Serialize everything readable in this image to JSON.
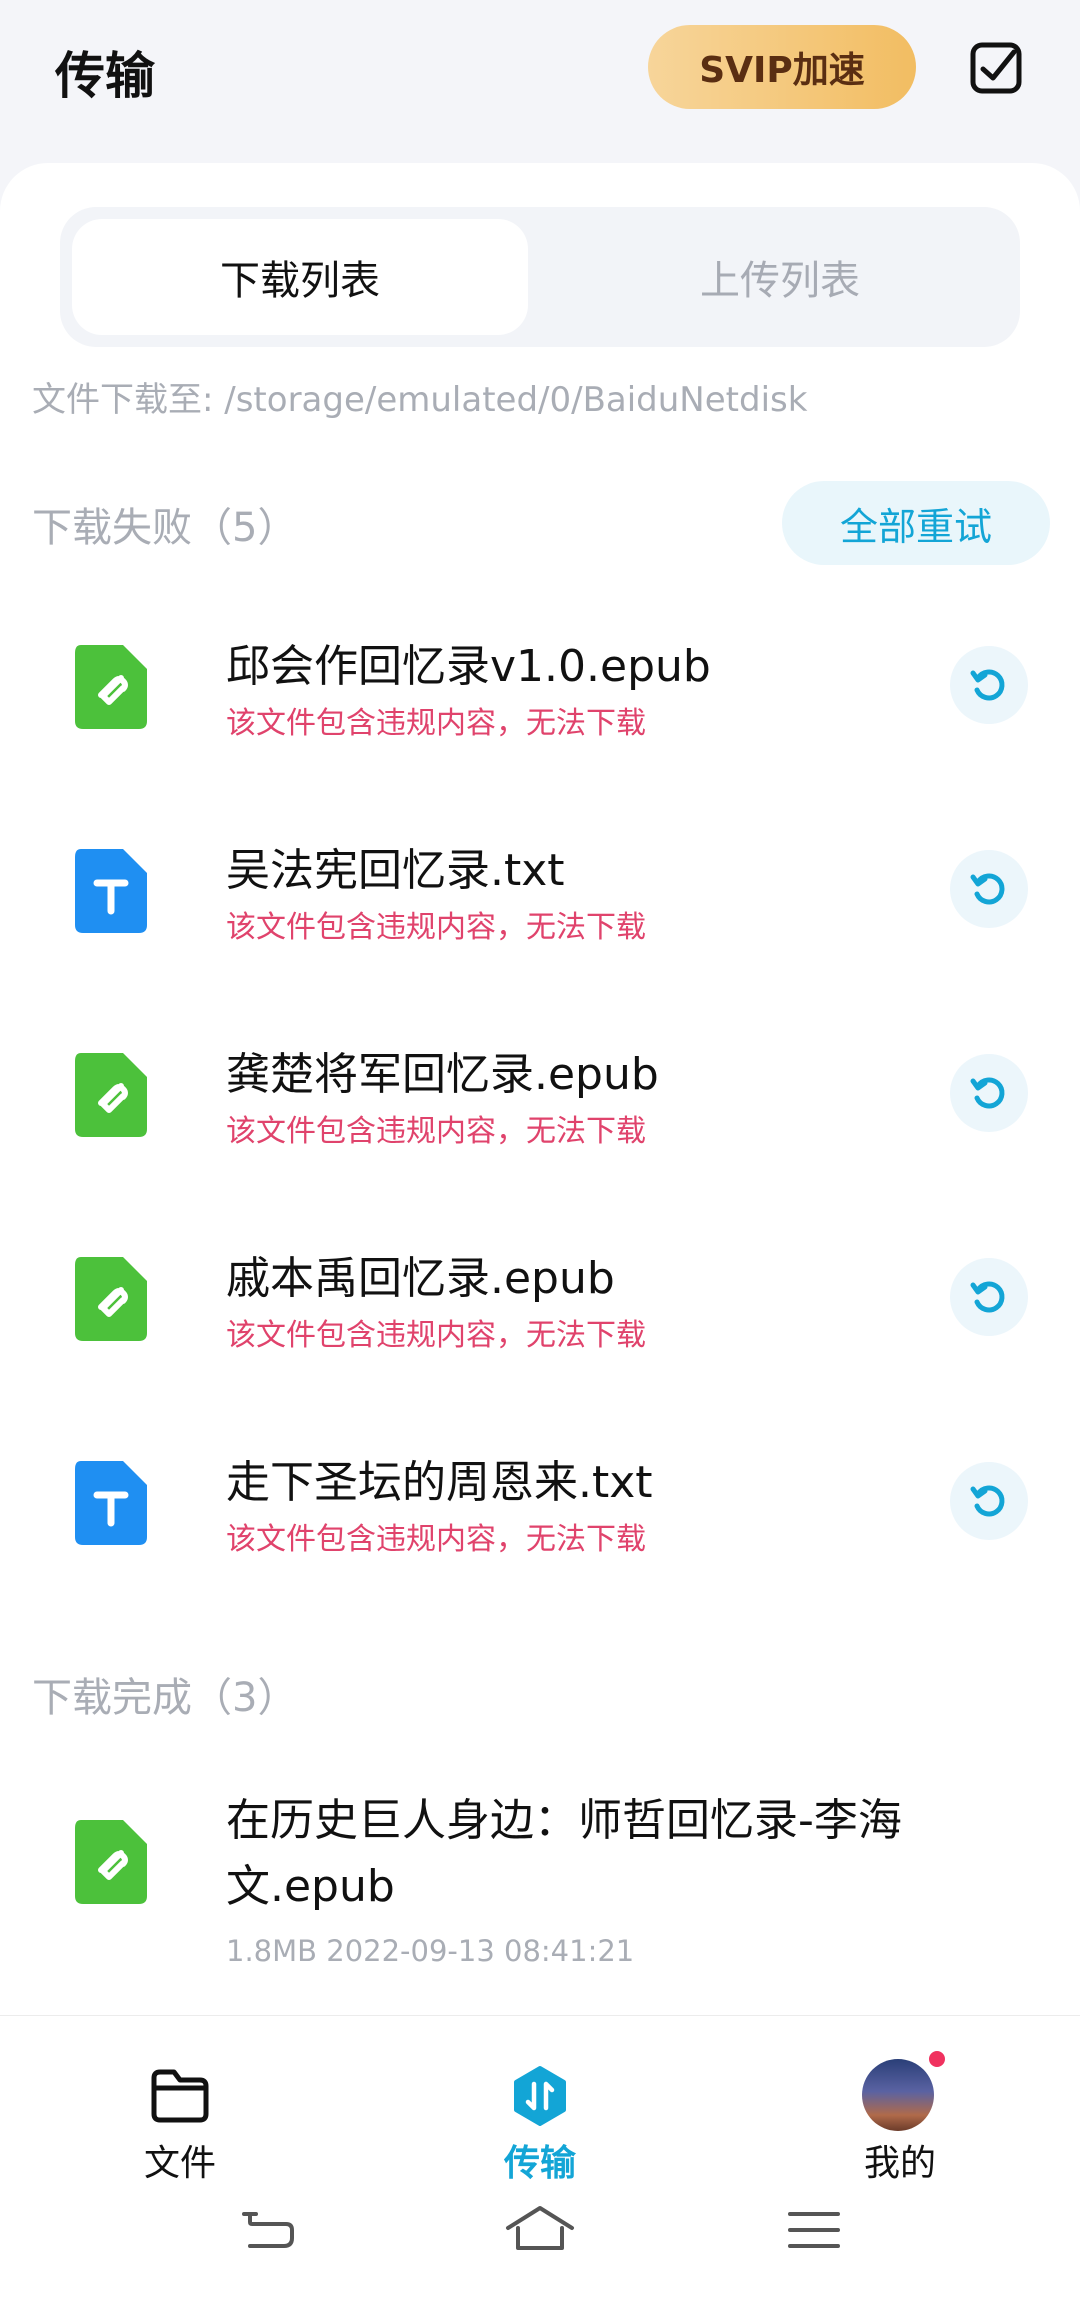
{
  "header": {
    "title": "传输",
    "svip_label": "SVIP加速",
    "edit_icon": "checkbox-edit-icon"
  },
  "tabs": [
    {
      "label": "下载列表",
      "active": true
    },
    {
      "label": "上传列表",
      "active": false
    }
  ],
  "download_path": "文件下载至: /storage/emulated/0/BaiduNetdisk",
  "failed_section": {
    "title": "下载失败（5）",
    "retry_all_label": "全部重试",
    "items": [
      {
        "name": "邱会作回忆录v1.0.epub",
        "type": "epub",
        "error": "该文件包含违规内容，无法下载"
      },
      {
        "name": "吴法宪回忆录.txt",
        "type": "txt",
        "error": "该文件包含违规内容，无法下载"
      },
      {
        "name": "龚楚将军回忆录.epub",
        "type": "epub",
        "error": "该文件包含违规内容，无法下载"
      },
      {
        "name": "戚本禹回忆录.epub",
        "type": "epub",
        "error": "该文件包含违规内容，无法下载"
      },
      {
        "name": "走下圣坛的周恩来.txt",
        "type": "txt",
        "error": "该文件包含违规内容，无法下载"
      }
    ]
  },
  "done_section": {
    "title": "下载完成（3）",
    "items": [
      {
        "name": "在历史巨人身边：师哲回忆录-李海文.epub",
        "type": "epub",
        "meta": "1.8MB 2022-09-13 08:41:21"
      }
    ]
  },
  "bottom_nav": [
    {
      "label": "文件",
      "icon": "folder-icon",
      "active": false
    },
    {
      "label": "传输",
      "icon": "transfer-icon",
      "active": true
    },
    {
      "label": "我的",
      "icon": "avatar",
      "active": false
    }
  ],
  "colors": {
    "accent": "#13a5d6",
    "error": "#e0436c",
    "epub_icon": "#4cc13b",
    "txt_icon": "#1f8ff2",
    "svip_gradient_start": "#f7d59a",
    "svip_gradient_end": "#f2bd62"
  }
}
